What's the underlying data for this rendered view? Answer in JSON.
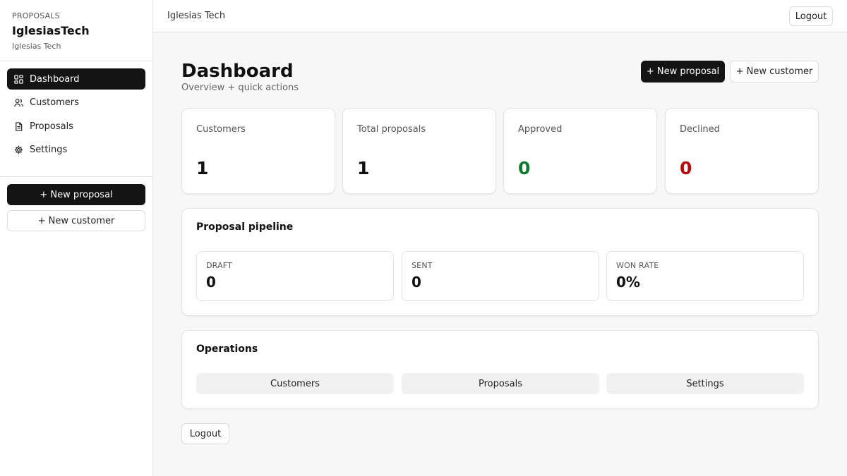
{
  "sidebar": {
    "kicker": "PROPOSALS",
    "brand": "IglesiasTech",
    "org": "Iglesias Tech",
    "nav": [
      {
        "label": "Dashboard",
        "icon": "grid-icon",
        "active": true
      },
      {
        "label": "Customers",
        "icon": "users-icon",
        "active": false
      },
      {
        "label": "Proposals",
        "icon": "document-icon",
        "active": false
      },
      {
        "label": "Settings",
        "icon": "gear-icon",
        "active": false
      }
    ],
    "new_proposal": "+ New proposal",
    "new_customer": "+ New customer"
  },
  "topbar": {
    "title": "Iglesias Tech",
    "logout": "Logout"
  },
  "header": {
    "title": "Dashboard",
    "subtitle": "Overview + quick actions",
    "new_proposal": "+ New proposal",
    "new_customer": "+ New customer"
  },
  "stats": [
    {
      "label": "Customers",
      "value": "1",
      "tone": "default"
    },
    {
      "label": "Total proposals",
      "value": "1",
      "tone": "default"
    },
    {
      "label": "Approved",
      "value": "0",
      "tone": "green"
    },
    {
      "label": "Declined",
      "value": "0",
      "tone": "red"
    }
  ],
  "colors": {
    "approved": "#117a30",
    "declined": "#b30d0d",
    "dark_button": "#141414"
  },
  "pipeline": {
    "title": "Proposal pipeline",
    "items": [
      {
        "label": "DRAFT",
        "value": "0"
      },
      {
        "label": "SENT",
        "value": "0"
      },
      {
        "label": "WON RATE",
        "value": "0%"
      }
    ]
  },
  "operations": {
    "title": "Operations",
    "buttons": [
      "Customers",
      "Proposals",
      "Settings"
    ]
  },
  "footer": {
    "logout": "Logout"
  }
}
